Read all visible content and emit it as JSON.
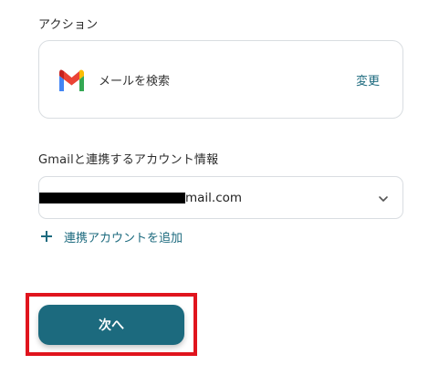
{
  "action_section": {
    "label": "アクション",
    "card": {
      "icon": "gmail-icon",
      "action_name": "メールを検索",
      "change_label": "変更"
    }
  },
  "account_section": {
    "label": "Gmailと連携するアカウント情報",
    "selected_value": "mail.com",
    "add_account_label": "連携アカウントを追加"
  },
  "next_button": {
    "label": "次へ"
  },
  "colors": {
    "accent": "#1c6a7e",
    "highlight": "#e0141d",
    "border": "#d9dde1"
  }
}
